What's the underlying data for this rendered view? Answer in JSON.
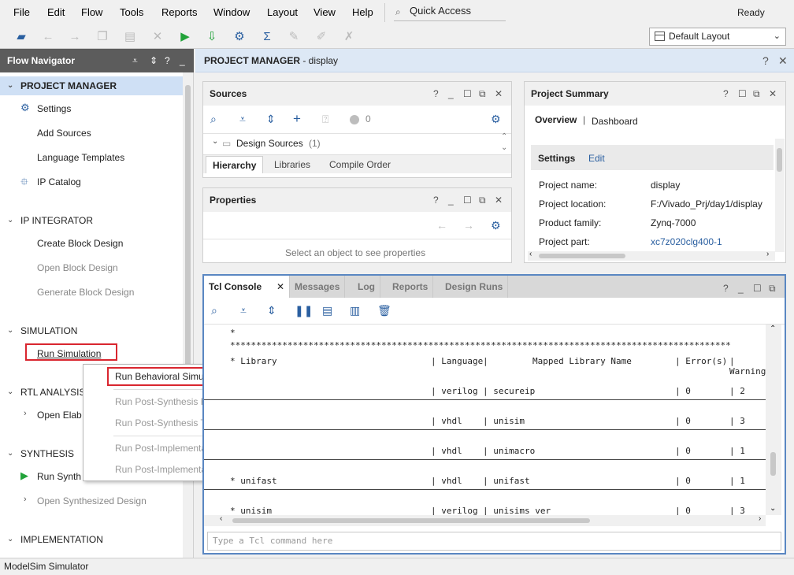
{
  "menubar": {
    "items": [
      {
        "label": "File"
      },
      {
        "label": "Edit"
      },
      {
        "label": "Flow"
      },
      {
        "label": "Tools"
      },
      {
        "label": "Reports"
      },
      {
        "label": "Window"
      },
      {
        "label": "Layout"
      },
      {
        "label": "View"
      },
      {
        "label": "Help"
      }
    ],
    "quick_access_placeholder": "Quick Access",
    "status": "Ready"
  },
  "toolbar": {
    "layout_select": "Default Layout"
  },
  "flow_navigator": {
    "title": "Flow Navigator",
    "sections": [
      {
        "label": "PROJECT MANAGER",
        "items": [
          "Settings",
          "Add Sources",
          "Language Templates",
          "IP Catalog"
        ]
      },
      {
        "label": "IP INTEGRATOR",
        "items": [
          "Create Block Design",
          "Open Block Design",
          "Generate Block Design"
        ]
      },
      {
        "label": "SIMULATION",
        "items": [
          "Run Simulation"
        ]
      },
      {
        "label": "RTL ANALYSIS",
        "items": [
          "Open Elab"
        ]
      },
      {
        "label": "SYNTHESIS",
        "items": [
          "Run Synth",
          "Open Synthesized Design"
        ]
      },
      {
        "label": "IMPLEMENTATION",
        "items": []
      }
    ]
  },
  "context_menu": {
    "items": [
      "Run Behavioral Simulation",
      "Run Post-Synthesis Functional Simulation",
      "Run Post-Synthesis Timing Simulation",
      "Run Post-Implementation Functional Simulation",
      "Run Post-Implementation Timing Simulation"
    ]
  },
  "project_manager": {
    "header_bold": "PROJECT MANAGER",
    "header_rest": " - display"
  },
  "sources": {
    "title": "Sources",
    "count_badge": "0",
    "tree_item": "Design Sources",
    "tree_count": "(1)",
    "tabs": [
      "Hierarchy",
      "Libraries",
      "Compile Order"
    ]
  },
  "properties": {
    "title": "Properties",
    "empty_text": "Select an object to see properties"
  },
  "summary": {
    "title": "Project Summary",
    "tabs": [
      "Overview",
      "Dashboard"
    ],
    "separator": "|",
    "section": "Settings",
    "edit": "Edit",
    "rows": [
      {
        "k": "Project name:",
        "v": "display"
      },
      {
        "k": "Project location:",
        "v": "F:/Vivado_Prj/day1/display"
      },
      {
        "k": "Product family:",
        "v": "Zynq-7000"
      },
      {
        "k": "Project part:",
        "v": "xc7z020clg400-1"
      }
    ]
  },
  "tcl": {
    "tabs": [
      "Tcl Console",
      "Messages",
      "Log",
      "Reports",
      "Design Runs"
    ],
    "line_star": "*",
    "stars": "************************************************************************************************",
    "header": [
      "* Library",
      "| Language",
      "|",
      "Mapped Library Name",
      "| Error(s)",
      "| Warnings"
    ],
    "rows": [
      {
        "lang": "| verilog",
        "map": "| secureip",
        "err": "| 0",
        "warn": "| 2",
        "lib": ""
      },
      {
        "lang": "| vhdl",
        "map": "| unisim",
        "err": "| 0",
        "warn": "| 3",
        "lib": ""
      },
      {
        "lang": "| vhdl",
        "map": "| unimacro",
        "err": "| 0",
        "warn": "| 1",
        "lib": ""
      },
      {
        "lang": "| vhdl",
        "map": "| unifast",
        "err": "| 0",
        "warn": "| 1",
        "lib": "*  unifast"
      },
      {
        "lang": "| verilog",
        "map": "| unisims_ver",
        "err": "| 0",
        "warn": "| 3",
        "lib": "*  unisim"
      }
    ],
    "input_placeholder": "Type a Tcl command here"
  },
  "statusbar": {
    "text": "ModelSim Simulator"
  }
}
